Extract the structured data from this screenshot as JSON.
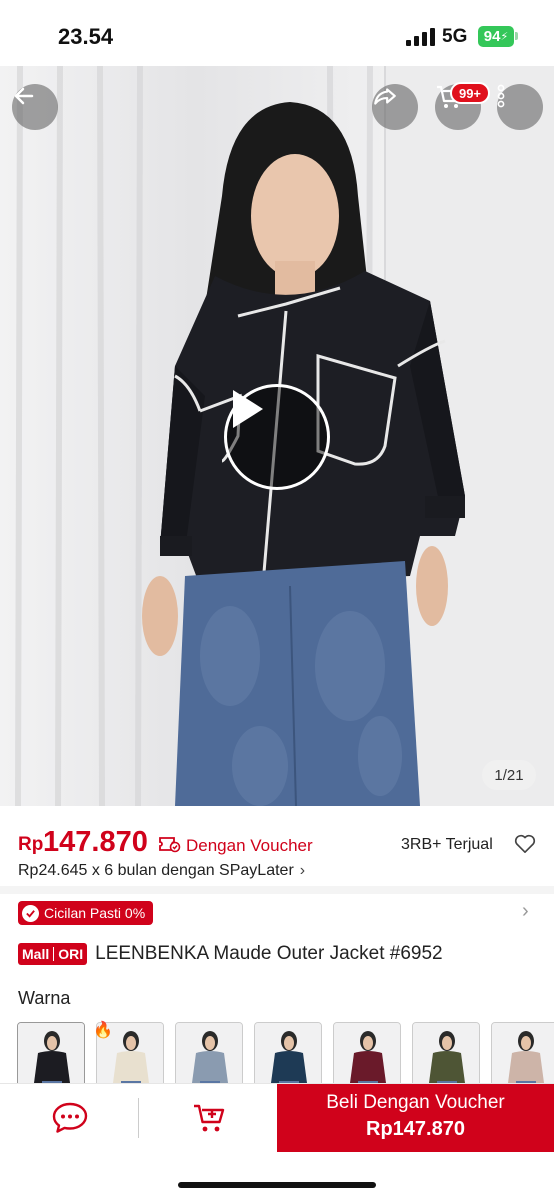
{
  "status_bar": {
    "time": "23.54",
    "network": "5G",
    "battery": "94"
  },
  "hero": {
    "cart_badge": "99+",
    "image_counter": "1/21",
    "icons": [
      "back-arrow-icon",
      "share-icon",
      "cart-icon",
      "more-icon",
      "play-icon"
    ]
  },
  "price": {
    "currency": "Rp",
    "amount": "147.870",
    "voucher_label": "Dengan Voucher",
    "sold": "3RB+ Terjual",
    "installment": "Rp24.645 x 6 bulan dengan SPayLater",
    "installment_chevron": "›"
  },
  "cicilan": {
    "label": "Cicilan Pasti 0%",
    "chevron": "›"
  },
  "product": {
    "badge_mall": "Mall",
    "badge_ori": "ORI",
    "title": "LEENBENKA Maude Outer Jacket #6952"
  },
  "variants": {
    "label": "Warna",
    "hot_icon": "🔥",
    "colors": [
      "#1c1c22",
      "#e8e0cf",
      "#8a9bb0",
      "#1e3a55",
      "#6a1a2a",
      "#4e5535",
      "#cdb4a8"
    ]
  },
  "bottom_bar": {
    "buy_line1": "Beli Dengan Voucher",
    "buy_line2": "Rp147.870"
  },
  "colors": {
    "brand": "#d0021b",
    "battery": "#34c759"
  }
}
